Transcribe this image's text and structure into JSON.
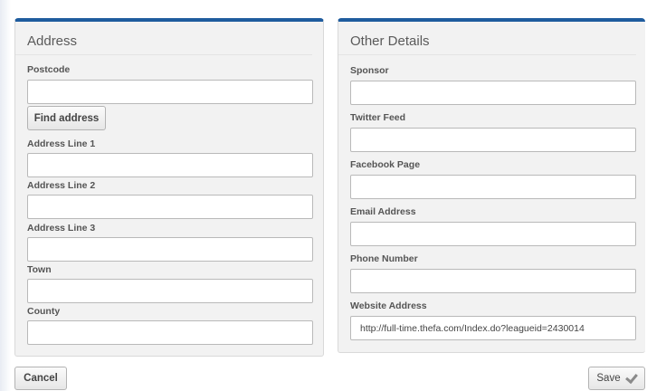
{
  "address": {
    "title": "Address",
    "postcode_label": "Postcode",
    "postcode_value": "",
    "find_address_label": "Find address",
    "line1_label": "Address Line 1",
    "line1_value": "",
    "line2_label": "Address Line 2",
    "line2_value": "",
    "line3_label": "Address Line 3",
    "line3_value": "",
    "town_label": "Town",
    "town_value": "",
    "county_label": "County",
    "county_value": ""
  },
  "other": {
    "title": "Other Details",
    "sponsor_label": "Sponsor",
    "sponsor_value": "",
    "twitter_label": "Twitter Feed",
    "twitter_value": "",
    "facebook_label": "Facebook Page",
    "facebook_value": "",
    "email_label": "Email Address",
    "email_value": "",
    "phone_label": "Phone Number",
    "phone_value": "",
    "website_label": "Website Address",
    "website_value": "http://full-time.thefa.com/Index.do?leagueid=2430014"
  },
  "actions": {
    "cancel_label": "Cancel",
    "save_label": "Save"
  },
  "colors": {
    "panel_accent": "#1f5c9e",
    "panel_bg": "#f2f2f2"
  }
}
